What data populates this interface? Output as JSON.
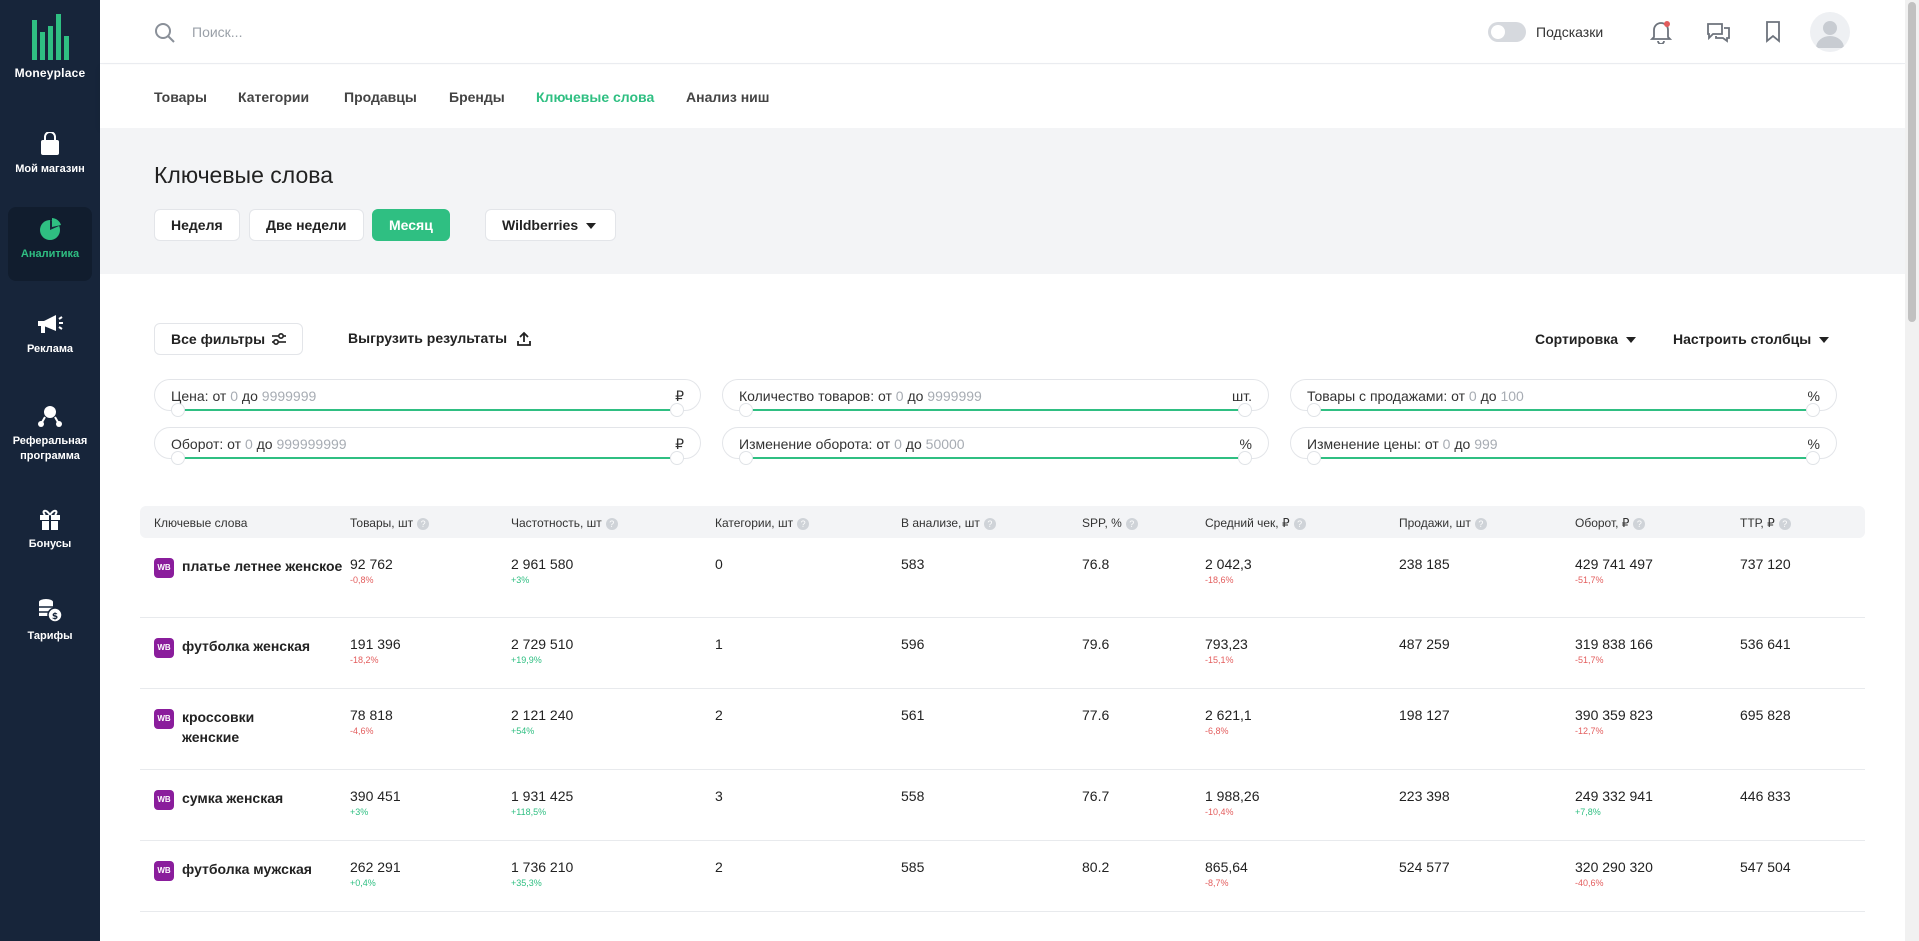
{
  "app": {
    "name": "Moneyplace"
  },
  "sidebar": {
    "items": [
      {
        "label": "Мой магазин",
        "icon": "shopping-bag-icon"
      },
      {
        "label": "Аналитика",
        "icon": "pie-chart-icon",
        "active": true
      },
      {
        "label": "Реклама",
        "icon": "megaphone-icon"
      },
      {
        "label": "Реферальная программа",
        "icon": "referral-network-icon"
      },
      {
        "label": "Бонусы",
        "icon": "gift-icon"
      },
      {
        "label": "Тарифы",
        "icon": "coins-icon"
      }
    ]
  },
  "topbar": {
    "search_placeholder": "Поиск...",
    "hints_label": "Подсказки",
    "hints_enabled": false
  },
  "nav": {
    "tabs": [
      {
        "label": "Товары"
      },
      {
        "label": "Категории"
      },
      {
        "label": "Продавцы"
      },
      {
        "label": "Бренды"
      },
      {
        "label": "Ключевые слова",
        "active": true
      },
      {
        "label": "Анализ ниш"
      }
    ]
  },
  "page": {
    "title": "Ключевые слова",
    "periods": [
      "Неделя",
      "Две недели",
      "Месяц"
    ],
    "active_period": "Месяц",
    "marketplace": "Wildberries"
  },
  "toolbar": {
    "all_filters": "Все фильтры",
    "export": "Выгрузить результаты",
    "sort": "Сортировка",
    "columns": "Настроить столбцы"
  },
  "filters": [
    {
      "label": "Цена: от",
      "from": "0",
      "to_label": "до",
      "to": "9999999",
      "unit": "₽"
    },
    {
      "label": "Количество товаров: от",
      "from": "0",
      "to_label": "до",
      "to": "9999999",
      "unit": "шт."
    },
    {
      "label": "Товары с продажами: от",
      "from": "0",
      "to_label": "до",
      "to": "100",
      "unit": "%"
    },
    {
      "label": "Оборот: от",
      "from": "0",
      "to_label": "до",
      "to": "999999999",
      "unit": "₽"
    },
    {
      "label": "Изменение оборота: от",
      "from": "0",
      "to_label": "до",
      "to": "50000",
      "unit": "%"
    },
    {
      "label": "Изменение цены: от",
      "from": "0",
      "to_label": "до",
      "to": "999",
      "unit": "%"
    }
  ],
  "table": {
    "headers": [
      "Ключевые слова",
      "Товары, шт",
      "Частотность, шт",
      "Категории, шт",
      "В анализе, шт",
      "SPP, %",
      "Средний чек, ₽",
      "Продажи, шт",
      "Оборот, ₽",
      "ТТР, ₽"
    ],
    "badge": "WB",
    "rows": [
      {
        "keyword": "платье летнее женское",
        "goods": "92 762",
        "goods_chg": "-0,8%",
        "freq": "2 961 580",
        "freq_chg": "+3%",
        "cats": "0",
        "analysis": "583",
        "spp": "76.8",
        "avg": "2 042,3",
        "avg_chg": "-18,6%",
        "sales": "238 185",
        "revenue": "429 741 497",
        "revenue_chg": "-51,7%",
        "ttr": "737 120"
      },
      {
        "keyword": "футболка женская",
        "goods": "191 396",
        "goods_chg": "-18,2%",
        "freq": "2 729 510",
        "freq_chg": "+19,9%",
        "cats": "1",
        "analysis": "596",
        "spp": "79.6",
        "avg": "793,23",
        "avg_chg": "-15,1%",
        "sales": "487 259",
        "revenue": "319 838 166",
        "revenue_chg": "-51,7%",
        "ttr": "536 641"
      },
      {
        "keyword": "кроссовки женские",
        "goods": "78 818",
        "goods_chg": "-4,6%",
        "freq": "2 121 240",
        "freq_chg": "+54%",
        "cats": "2",
        "analysis": "561",
        "spp": "77.6",
        "avg": "2 621,1",
        "avg_chg": "-6,8%",
        "sales": "198 127",
        "revenue": "390 359 823",
        "revenue_chg": "-12,7%",
        "ttr": "695 828"
      },
      {
        "keyword": "сумка женская",
        "goods": "390 451",
        "goods_chg": "+3%",
        "freq": "1 931 425",
        "freq_chg": "+118,5%",
        "cats": "3",
        "analysis": "558",
        "spp": "76.7",
        "avg": "1 988,26",
        "avg_chg": "-10,4%",
        "sales": "223 398",
        "revenue": "249 332 941",
        "revenue_chg": "+7,8%",
        "ttr": "446 833"
      },
      {
        "keyword": "футболка мужская",
        "goods": "262 291",
        "goods_chg": "+0,4%",
        "freq": "1 736 210",
        "freq_chg": "+35,3%",
        "cats": "2",
        "analysis": "585",
        "spp": "80.2",
        "avg": "865,64",
        "avg_chg": "-8,7%",
        "sales": "524 577",
        "revenue": "320 290 320",
        "revenue_chg": "-40,6%",
        "ttr": "547 504"
      }
    ]
  },
  "colors": {
    "accent": "#2fbf82",
    "sidebar": "#17253a",
    "negative": "#e35d5d",
    "wb_badge": "#8a1d9c"
  }
}
